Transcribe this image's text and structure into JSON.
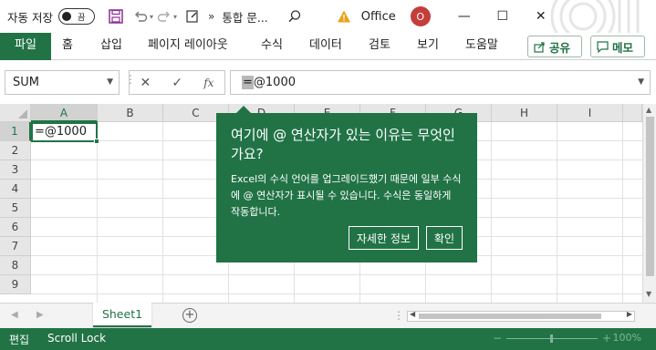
{
  "titlebar": {
    "autosave_label": "자동 저장",
    "autosave_state": "끔",
    "more": "»",
    "doc_title": "통합 문...",
    "app_name": "Office",
    "avatar_initial": "O",
    "icons": [
      "save-icon",
      "undo-icon",
      "redo-icon",
      "touch-mode-icon",
      "search-icon",
      "warning-icon",
      "minimize-icon",
      "restore-icon",
      "close-icon"
    ],
    "window_controls": {
      "minimize": "—",
      "restore": "☐",
      "close": "✕"
    }
  },
  "ribbon": {
    "tabs": [
      "파일",
      "홈",
      "삽입",
      "페이지 레이아웃",
      "수식",
      "데이터",
      "검토",
      "보기",
      "도움말"
    ],
    "share_label": "공유",
    "comments_label": "메모",
    "accent": "#217346"
  },
  "formula_bar": {
    "name_box": "SUM",
    "cancel": "✕",
    "enter": "✓",
    "fx": "fx",
    "formula_prefix": "=",
    "formula_rest": "@1000"
  },
  "grid": {
    "columns": [
      "A",
      "B",
      "C",
      "D",
      "E",
      "F",
      "G",
      "H",
      "I"
    ],
    "rows": [
      "1",
      "2",
      "3",
      "4",
      "5",
      "6",
      "7",
      "8",
      "9"
    ],
    "selected_cell": "A1",
    "cell_a1": "=@1000"
  },
  "callout": {
    "title": "여기에 @ 연산자가 있는 이유는 무엇인가요?",
    "body": "Excel의 수식 언어를 업그레이드했기 때문에 일부 수식에 @ 연산자가 표시될 수 있습니다. 수식은 동일하게 작동합니다.",
    "learn_more": "자세한 정보",
    "ok": "확인"
  },
  "sheets": {
    "tabs": [
      "Sheet1"
    ],
    "add": "+",
    "nav_prev": "◀",
    "nav_next": "▶"
  },
  "statusbar": {
    "mode": "편집",
    "scroll_lock": "Scroll Lock",
    "zoom": "100%"
  }
}
